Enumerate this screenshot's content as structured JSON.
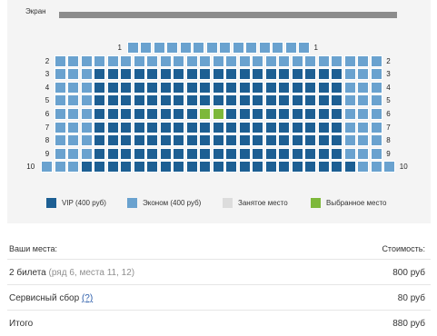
{
  "screen": {
    "label": "Экран"
  },
  "legend": [
    {
      "key": "vip",
      "label": "VIP (400 руб)",
      "color": "#1d5f93"
    },
    {
      "key": "econ",
      "label": "Эконом (400 руб)",
      "color": "#6aa2cf"
    },
    {
      "key": "occupied",
      "label": "Занятое место",
      "color": "#dcdcdc"
    },
    {
      "key": "selected",
      "label": "Выбранное место",
      "color": "#7db83a"
    }
  ],
  "rows": [
    {
      "label": "1",
      "seats": 14,
      "vip_from": 0,
      "vip_to": -1,
      "selected": []
    },
    {
      "label": "2",
      "seats": 25,
      "vip_from": 0,
      "vip_to": -1,
      "selected": []
    },
    {
      "label": "3",
      "seats": 25,
      "vip_from": 3,
      "vip_to": 21,
      "selected": []
    },
    {
      "label": "4",
      "seats": 25,
      "vip_from": 3,
      "vip_to": 21,
      "selected": []
    },
    {
      "label": "5",
      "seats": 25,
      "vip_from": 3,
      "vip_to": 21,
      "selected": []
    },
    {
      "label": "6",
      "seats": 25,
      "vip_from": 3,
      "vip_to": 21,
      "selected": [
        11,
        12
      ]
    },
    {
      "label": "7",
      "seats": 25,
      "vip_from": 3,
      "vip_to": 21,
      "selected": []
    },
    {
      "label": "8",
      "seats": 25,
      "vip_from": 3,
      "vip_to": 21,
      "selected": []
    },
    {
      "label": "9",
      "seats": 25,
      "vip_from": 3,
      "vip_to": 21,
      "selected": []
    },
    {
      "label": "10",
      "seats": 27,
      "vip_from": 3,
      "vip_to": 23,
      "selected": []
    }
  ],
  "summary": {
    "header_left": "Ваши места:",
    "header_right": "Стоимость:",
    "tickets_label": "2 билета",
    "tickets_detail": "(ряд 6, места 11, 12)",
    "tickets_price": "800 руб",
    "service_label": "Сервисный сбор",
    "service_help": "(?)",
    "service_price": "80 руб",
    "total_label": "Итого",
    "total_price": "880 руб"
  }
}
